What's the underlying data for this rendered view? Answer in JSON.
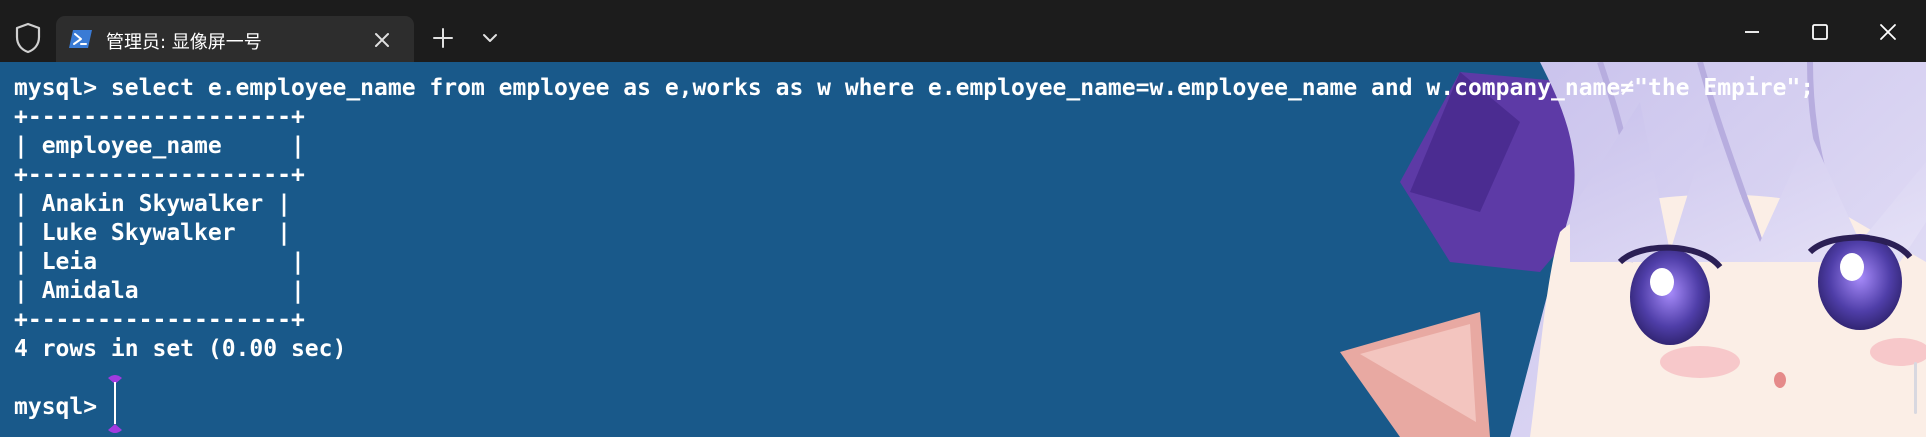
{
  "titlebar": {
    "tab_title": "管理员: 显像屏一号",
    "tab_icon": "powershell-icon",
    "shield_icon": "shield-icon",
    "new_tab_icon": "plus-icon",
    "dropdown_icon": "chevron-down-icon",
    "window_buttons": [
      "minimize-icon",
      "maximize-icon",
      "close-icon"
    ]
  },
  "terminal": {
    "lines": [
      "mysql> select e.employee_name from employee as e,works as w where e.employee_name=w.employee_name and w.company_name≠\"the Empire\";",
      "+-------------------+",
      "| employee_name     |",
      "+-------------------+",
      "| Anakin Skywalker |",
      "| Luke Skywalker   |",
      "| Leia              |",
      "| Amidala           |",
      "+-------------------+",
      "4 rows in set (0.00 sec)",
      "",
      "mysql> "
    ],
    "background_color": "#19598a",
    "text_color": "#ffffff",
    "cursor_color": "#a23be0"
  }
}
